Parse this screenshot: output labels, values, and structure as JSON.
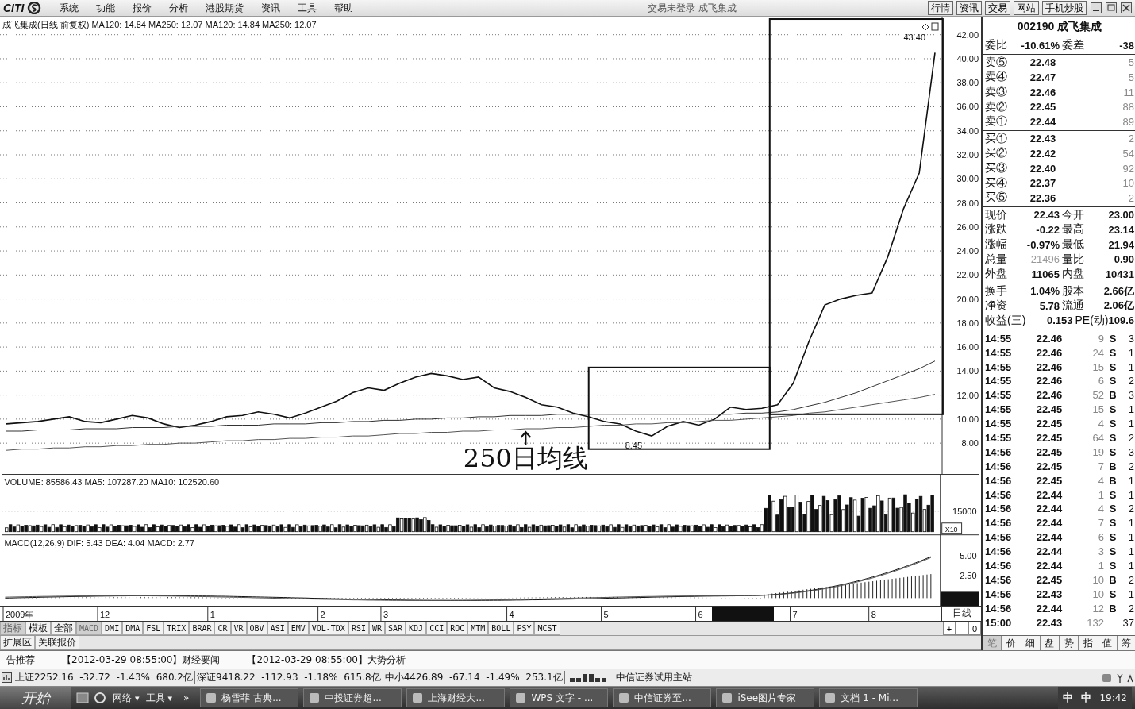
{
  "menu_bar": {
    "logo": "CITI",
    "menus": [
      "系统",
      "功能",
      "报价",
      "分析",
      "港股期货",
      "资讯",
      "工具",
      "帮助"
    ],
    "title": "交易未登录 成飞集成",
    "buttons": [
      "行情",
      "资讯",
      "交易",
      "网站",
      "手机炒股"
    ]
  },
  "chart": {
    "title": "成飞集成(日线 前复权) MA120: 14.84 MA250: 12.07 MA120: 14.84 MA250: 12.07",
    "chart_data": {
      "type": "line",
      "ylim": [
        5.3,
        43.5
      ],
      "grid": true,
      "yticks": [
        {
          "value": 8,
          "label": "8.00"
        },
        {
          "value": 10,
          "label": "10.00"
        },
        {
          "value": 12,
          "label": "12.00"
        },
        {
          "value": 14,
          "label": "14.00"
        },
        {
          "value": 16,
          "label": "16.00"
        },
        {
          "value": 18,
          "label": "18.00"
        },
        {
          "value": 20,
          "label": "20.00"
        },
        {
          "value": 22,
          "label": "22.00"
        },
        {
          "value": 24,
          "label": "24.00"
        },
        {
          "value": 26,
          "label": "26.00"
        },
        {
          "value": 28,
          "label": "28.00"
        },
        {
          "value": 30,
          "label": "30.00"
        },
        {
          "value": 32,
          "label": "32.00"
        },
        {
          "value": 34,
          "label": "34.00"
        },
        {
          "value": 36,
          "label": "36.00"
        },
        {
          "value": 38,
          "label": "38.00"
        },
        {
          "value": 40,
          "label": "40.00"
        },
        {
          "value": 42,
          "label": "42.00"
        }
      ],
      "series": [
        {
          "color": "#111111",
          "values": [
            9.6,
            9.7,
            9.8,
            10.0,
            10.2,
            9.8,
            9.7,
            10.0,
            10.3,
            10.1,
            9.6,
            9.3,
            9.5,
            9.8,
            10.2,
            10.3,
            10.6,
            10.4,
            10.1,
            10.5,
            11.0,
            11.5,
            12.2,
            12.6,
            12.4,
            13.0,
            13.5,
            13.8,
            13.6,
            13.3,
            13.5,
            12.6,
            12.3,
            11.8,
            11.2,
            11.0,
            10.5,
            10.2,
            9.8,
            9.6,
            9.0,
            8.6,
            9.4,
            9.8,
            9.5,
            10.0,
            11.0,
            10.8,
            10.9,
            11.2,
            13.0,
            16.5,
            19.5,
            20.0,
            20.3,
            20.5,
            23.5,
            27.5,
            30.5,
            40.5
          ]
        },
        {
          "color": "#333333",
          "values": [
            9.0,
            9.0,
            9.1,
            9.1,
            9.1,
            9.2,
            9.2,
            9.2,
            9.3,
            9.3,
            9.3,
            9.4,
            9.4,
            9.4,
            9.5,
            9.5,
            9.5,
            9.6,
            9.6,
            9.6,
            9.7,
            9.7,
            9.8,
            9.8,
            9.9,
            9.9,
            10.0,
            10.0,
            10.1,
            10.1,
            10.2,
            10.2,
            10.3,
            10.3,
            10.3,
            10.4,
            10.4,
            10.4,
            10.4,
            10.4,
            10.4,
            10.4,
            10.4,
            10.4,
            10.4,
            10.4,
            10.4,
            10.5,
            10.5,
            10.6,
            10.8,
            11.1,
            11.4,
            11.8,
            12.2,
            12.7,
            13.2,
            13.7,
            14.2,
            14.84
          ]
        },
        {
          "color": "#555555",
          "values": [
            7.4,
            7.5,
            7.5,
            7.6,
            7.6,
            7.7,
            7.7,
            7.8,
            7.8,
            7.9,
            7.9,
            8.0,
            8.0,
            8.1,
            8.2,
            8.2,
            8.3,
            8.3,
            8.4,
            8.4,
            8.5,
            8.5,
            8.6,
            8.6,
            8.7,
            8.8,
            8.8,
            8.9,
            8.9,
            9.0,
            9.0,
            9.1,
            9.1,
            9.2,
            9.2,
            9.3,
            9.3,
            9.4,
            9.5,
            9.5,
            9.6,
            9.6,
            9.7,
            9.7,
            9.8,
            9.9,
            9.9,
            10.0,
            10.1,
            10.2,
            10.3,
            10.5,
            10.6,
            10.8,
            11.0,
            11.2,
            11.4,
            11.6,
            11.8,
            12.07
          ]
        }
      ],
      "annotations": [
        {
          "text": "43.40"
        },
        {
          "text": "8.45"
        }
      ]
    },
    "marker": "250日均线",
    "x_axis": [
      "2009年",
      "12",
      "1",
      "2",
      "3",
      "4",
      "5",
      "6",
      "7",
      "8"
    ],
    "volume": {
      "title": "VOLUME: 85586.43 MA5: 107287.20 MA10: 102520.60",
      "tick": "15000",
      "scale": "X10"
    },
    "macd": {
      "title": "MACD(12,26,9) DIF: 5.43 DEA: 4.04 MACD: 2.77",
      "ticks": [
        "5.00",
        "2.50"
      ]
    },
    "period": "日线",
    "zoom_buttons": [
      "+",
      "-",
      "0"
    ]
  },
  "indicator_tabs": [
    {
      "label": "指标",
      "selected": true
    },
    {
      "label": "模板",
      "selected": false
    },
    {
      "label": "全部",
      "selected": false
    },
    {
      "label": "MACD",
      "selected": true
    },
    {
      "label": "DMI",
      "selected": false
    },
    {
      "label": "DMA",
      "selected": false
    },
    {
      "label": "FSL",
      "selected": false
    },
    {
      "label": "TRIX",
      "selected": false
    },
    {
      "label": "BRAR",
      "selected": false
    },
    {
      "label": "CR",
      "selected": false
    },
    {
      "label": "VR",
      "selected": false
    },
    {
      "label": "OBV",
      "selected": false
    },
    {
      "label": "ASI",
      "selected": false
    },
    {
      "label": "EMV",
      "selected": false
    },
    {
      "label": "VOL-TDX",
      "selected": false
    },
    {
      "label": "RSI",
      "selected": false
    },
    {
      "label": "WR",
      "selected": false
    },
    {
      "label": "SAR",
      "selected": false
    },
    {
      "label": "KDJ",
      "selected": false
    },
    {
      "label": "CCI",
      "selected": false
    },
    {
      "label": "ROC",
      "selected": false
    },
    {
      "label": "MTM",
      "selected": false
    },
    {
      "label": "BOLL",
      "selected": false
    },
    {
      "label": "PSY",
      "selected": false
    },
    {
      "label": "MCST",
      "selected": false
    }
  ],
  "extra_tabs": [
    "扩展区",
    "关联报价"
  ],
  "quote": {
    "code_name": "002190 成飞集成",
    "ratio": [
      "委比",
      "-10.61%",
      "委差",
      "-38"
    ],
    "sells": [
      {
        "label": "卖⑤",
        "price": "22.48",
        "volume": "5"
      },
      {
        "label": "卖④",
        "price": "22.47",
        "volume": "5"
      },
      {
        "label": "卖③",
        "price": "22.46",
        "volume": "11"
      },
      {
        "label": "卖②",
        "price": "22.45",
        "volume": "88"
      },
      {
        "label": "卖①",
        "price": "22.44",
        "volume": "89"
      }
    ],
    "buys": [
      {
        "label": "买①",
        "price": "22.43",
        "volume": "2"
      },
      {
        "label": "买②",
        "price": "22.42",
        "volume": "54"
      },
      {
        "label": "买③",
        "price": "22.40",
        "volume": "92"
      },
      {
        "label": "买④",
        "price": "22.37",
        "volume": "10"
      },
      {
        "label": "买⑤",
        "price": "22.36",
        "volume": "2"
      }
    ],
    "stats": [
      {
        "label": "现价",
        "value": "22.43",
        "label2": "今开",
        "value2": "23.00",
        "muted": false
      },
      {
        "label": "涨跌",
        "value": "-0.22",
        "label2": "最高",
        "value2": "23.14",
        "muted": false
      },
      {
        "label": "涨幅",
        "value": "-0.97%",
        "label2": "最低",
        "value2": "21.94",
        "muted": false
      },
      {
        "label": "总量",
        "value": "21496",
        "label2": "量比",
        "value2": "0.90",
        "muted": true
      },
      {
        "label": "外盘",
        "value": "11065",
        "label2": "内盘",
        "value2": "10431",
        "muted": false
      }
    ],
    "finance": [
      {
        "label": "换手",
        "value": "1.04%",
        "label2": "股本",
        "value2": "2.66亿"
      },
      {
        "label": "净资",
        "value": "5.78",
        "label2": "流通",
        "value2": "2.06亿"
      },
      {
        "label": "收益(三)",
        "value": "0.153",
        "label2": "PE(动)",
        "value2": "109.6"
      }
    ],
    "ticks": [
      {
        "time": "14:55",
        "price": "22.46",
        "volume": "9",
        "side": "S",
        "count": "3"
      },
      {
        "time": "14:55",
        "price": "22.46",
        "volume": "24",
        "side": "S",
        "count": "1"
      },
      {
        "time": "14:55",
        "price": "22.46",
        "volume": "15",
        "side": "S",
        "count": "1"
      },
      {
        "time": "14:55",
        "price": "22.46",
        "volume": "6",
        "side": "S",
        "count": "2"
      },
      {
        "time": "14:55",
        "price": "22.46",
        "volume": "52",
        "side": "B",
        "count": "3"
      },
      {
        "time": "14:55",
        "price": "22.45",
        "volume": "15",
        "side": "S",
        "count": "1"
      },
      {
        "time": "14:55",
        "price": "22.45",
        "volume": "4",
        "side": "S",
        "count": "1"
      },
      {
        "time": "14:55",
        "price": "22.45",
        "volume": "64",
        "side": "S",
        "count": "2"
      },
      {
        "time": "14:56",
        "price": "22.45",
        "volume": "19",
        "side": "S",
        "count": "3"
      },
      {
        "time": "14:56",
        "price": "22.45",
        "volume": "7",
        "side": "B",
        "count": "2"
      },
      {
        "time": "14:56",
        "price": "22.45",
        "volume": "4",
        "side": "B",
        "count": "1"
      },
      {
        "time": "14:56",
        "price": "22.44",
        "volume": "1",
        "side": "S",
        "count": "1"
      },
      {
        "time": "14:56",
        "price": "22.44",
        "volume": "4",
        "side": "S",
        "count": "2"
      },
      {
        "time": "14:56",
        "price": "22.44",
        "volume": "7",
        "side": "S",
        "count": "1"
      },
      {
        "time": "14:56",
        "price": "22.44",
        "volume": "6",
        "side": "S",
        "count": "1"
      },
      {
        "time": "14:56",
        "price": "22.44",
        "volume": "3",
        "side": "S",
        "count": "1"
      },
      {
        "time": "14:56",
        "price": "22.44",
        "volume": "1",
        "side": "S",
        "count": "1"
      },
      {
        "time": "14:56",
        "price": "22.45",
        "volume": "10",
        "side": "B",
        "count": "2"
      },
      {
        "time": "14:56",
        "price": "22.43",
        "volume": "10",
        "side": "S",
        "count": "1"
      },
      {
        "time": "14:56",
        "price": "22.44",
        "volume": "12",
        "side": "B",
        "count": "2"
      },
      {
        "time": "15:00",
        "price": "22.43",
        "volume": "132",
        "count": "37"
      }
    ],
    "tabs": [
      {
        "label": "笔",
        "selected": true
      },
      {
        "label": "价",
        "selected": false
      },
      {
        "label": "细",
        "selected": false
      },
      {
        "label": "盘",
        "selected": false
      },
      {
        "label": "势",
        "selected": false
      },
      {
        "label": "指",
        "selected": false
      },
      {
        "label": "值",
        "selected": false
      },
      {
        "label": "筹",
        "selected": false
      }
    ]
  },
  "news": [
    "告推荐",
    "【2012-03-29 08:55:00】财经要闻",
    "【2012-03-29 08:55:00】大势分析"
  ],
  "index_bar": [
    "上证2252.16  -32.72  -1.43%  680.2亿",
    "深证9418.22  -112.93  -1.18%  615.8亿",
    "中小4426.89  -67.14  -1.49%  253.1亿"
  ],
  "server": "中信证券试用主站",
  "taskbar": {
    "start": "开始",
    "quick": [
      "网络",
      "工具"
    ],
    "more": "»",
    "caret": "▾",
    "items": [
      "杨雪菲 古典...",
      "中投证券超...",
      "上海财经大...",
      "WPS 文字 - ...",
      "中信证券至...",
      "iSee图片专家",
      "文档 1 - Mi..."
    ],
    "tray": [
      "中",
      "中"
    ],
    "clock": "19:42"
  }
}
